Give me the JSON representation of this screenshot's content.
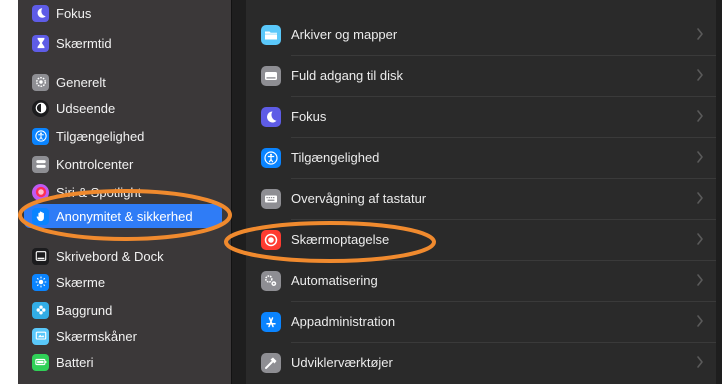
{
  "sidebar": {
    "items": [
      {
        "id": "fokus",
        "label": "Fokus",
        "icon": "moon-icon",
        "color": "#5e5ce6"
      },
      {
        "id": "skaermtid",
        "label": "Skærmtid",
        "icon": "hourglass-icon",
        "color": "#5e5ce6"
      },
      {
        "id": "generelt",
        "label": "Generelt",
        "icon": "gear-icon",
        "color": "#8e8e93"
      },
      {
        "id": "udseende",
        "label": "Udseende",
        "icon": "appearance-icon",
        "color": "#1c1c1e"
      },
      {
        "id": "tilgaengelighed",
        "label": "Tilgængelighed",
        "icon": "accessibility-icon",
        "color": "#0a84ff"
      },
      {
        "id": "kontrolcenter",
        "label": "Kontrolcenter",
        "icon": "control-center-icon",
        "color": "#8e8e93"
      },
      {
        "id": "siri",
        "label": "Siri & Spotlight",
        "icon": "siri-icon",
        "color": "#bf5af2"
      },
      {
        "id": "anonymitet",
        "label": "Anonymitet & sikkerhed",
        "icon": "hand-icon",
        "color": "#0a84ff",
        "selected": true
      },
      {
        "id": "skrivebord",
        "label": "Skrivebord & Dock",
        "icon": "dock-icon",
        "color": "#1c1c1e"
      },
      {
        "id": "skaerme",
        "label": "Skærme",
        "icon": "sun-icon",
        "color": "#0a84ff"
      },
      {
        "id": "baggrund",
        "label": "Baggrund",
        "icon": "flower-icon",
        "color": "#32ade6"
      },
      {
        "id": "skaermskaaner",
        "label": "Skærmskåner",
        "icon": "screensaver-icon",
        "color": "#5ac8fa"
      },
      {
        "id": "batteri",
        "label": "Batteri",
        "icon": "battery-icon",
        "color": "#30d158"
      }
    ]
  },
  "content": {
    "rows": [
      {
        "id": "arkiver",
        "label": "Arkiver og mapper",
        "icon": "folder-icon",
        "color": "#5ac8fa"
      },
      {
        "id": "fuld-adgang",
        "label": "Fuld adgang til disk",
        "icon": "disk-icon",
        "color": "#8e8e93"
      },
      {
        "id": "fokus",
        "label": "Fokus",
        "icon": "moon-icon",
        "color": "#5e5ce6"
      },
      {
        "id": "tilgaengelighed",
        "label": "Tilgængelighed",
        "icon": "accessibility-icon",
        "color": "#0a84ff"
      },
      {
        "id": "tastatur",
        "label": "Overvågning af tastatur",
        "icon": "keyboard-icon",
        "color": "#8e8e93"
      },
      {
        "id": "skaermoptagelse",
        "label": "Skærmoptagelse",
        "icon": "record-icon",
        "color": "#ff3b30"
      },
      {
        "id": "automatisering",
        "label": "Automatisering",
        "icon": "gears-icon",
        "color": "#8e8e93"
      },
      {
        "id": "appadministration",
        "label": "Appadministration",
        "icon": "app-store-icon",
        "color": "#0a84ff"
      },
      {
        "id": "udvikler",
        "label": "Udviklerværktøjer",
        "icon": "hammer-icon",
        "color": "#8e8e93"
      }
    ]
  },
  "annotations": {
    "highlight_color": "#f08a2e"
  }
}
